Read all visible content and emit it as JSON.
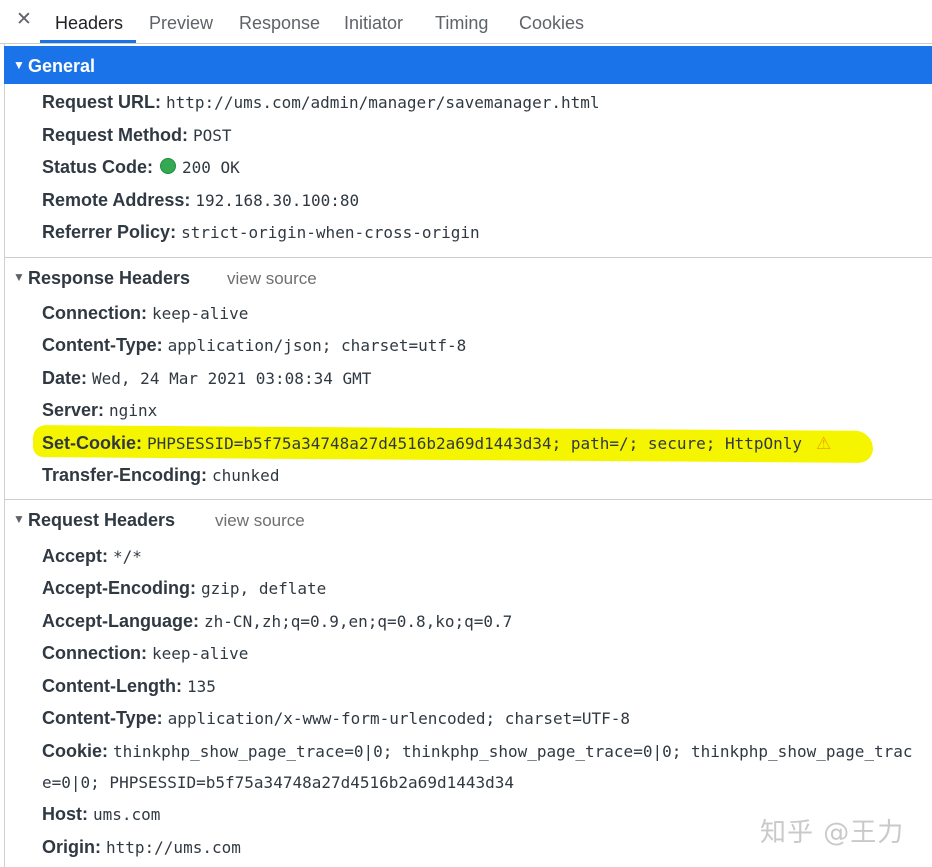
{
  "tabs": {
    "close_glyph": "✕",
    "items": [
      {
        "label": "Headers"
      },
      {
        "label": "Preview"
      },
      {
        "label": "Response"
      },
      {
        "label": "Initiator"
      },
      {
        "label": "Timing"
      },
      {
        "label": "Cookies"
      }
    ],
    "active": "Headers",
    "accent_color": "#1a73e8"
  },
  "general": {
    "title": "General",
    "rows": [
      {
        "key": "Request URL:",
        "value": "http://ums.com/admin/manager/savemanager.html"
      },
      {
        "key": "Request Method:",
        "value": "POST"
      },
      {
        "key": "Status Code:",
        "value": "200 OK",
        "status_color": "#34a853"
      },
      {
        "key": "Remote Address:",
        "value": "192.168.30.100:80"
      },
      {
        "key": "Referrer Policy:",
        "value": "strict-origin-when-cross-origin"
      }
    ]
  },
  "response_headers": {
    "title": "Response Headers",
    "view_source": "view source",
    "rows": [
      {
        "key": "Connection:",
        "value": "keep-alive"
      },
      {
        "key": "Content-Type:",
        "value": "application/json; charset=utf-8"
      },
      {
        "key": "Date:",
        "value": "Wed, 24 Mar 2021 03:08:34 GMT"
      },
      {
        "key": "Server:",
        "value": "nginx"
      },
      {
        "key": "Set-Cookie:",
        "value": "PHPSESSID=b5f75a34748a27d4516b2a69d1443d34; path=/; secure; HttpOnly",
        "warning_icon": "warning-triangle-icon",
        "highlight_color": "#f6f500"
      },
      {
        "key": "Transfer-Encoding:",
        "value": "chunked"
      }
    ]
  },
  "request_headers": {
    "title": "Request Headers",
    "view_source": "view source",
    "rows": [
      {
        "key": "Accept:",
        "value": "*/*"
      },
      {
        "key": "Accept-Encoding:",
        "value": "gzip, deflate"
      },
      {
        "key": "Accept-Language:",
        "value": "zh-CN,zh;q=0.9,en;q=0.8,ko;q=0.7"
      },
      {
        "key": "Connection:",
        "value": "keep-alive"
      },
      {
        "key": "Content-Length:",
        "value": "135"
      },
      {
        "key": "Content-Type:",
        "value": "application/x-www-form-urlencoded; charset=UTF-8"
      },
      {
        "key": "Cookie:",
        "value": "thinkphp_show_page_trace=0|0; thinkphp_show_page_trace=0|0; thinkphp_show_page_trac",
        "continuation": "e=0|0; PHPSESSID=b5f75a34748a27d4516b2a69d1443d34"
      },
      {
        "key": "Host:",
        "value": "ums.com"
      },
      {
        "key": "Origin:",
        "value": "http://ums.com"
      }
    ]
  },
  "watermark": "知乎 @王力"
}
